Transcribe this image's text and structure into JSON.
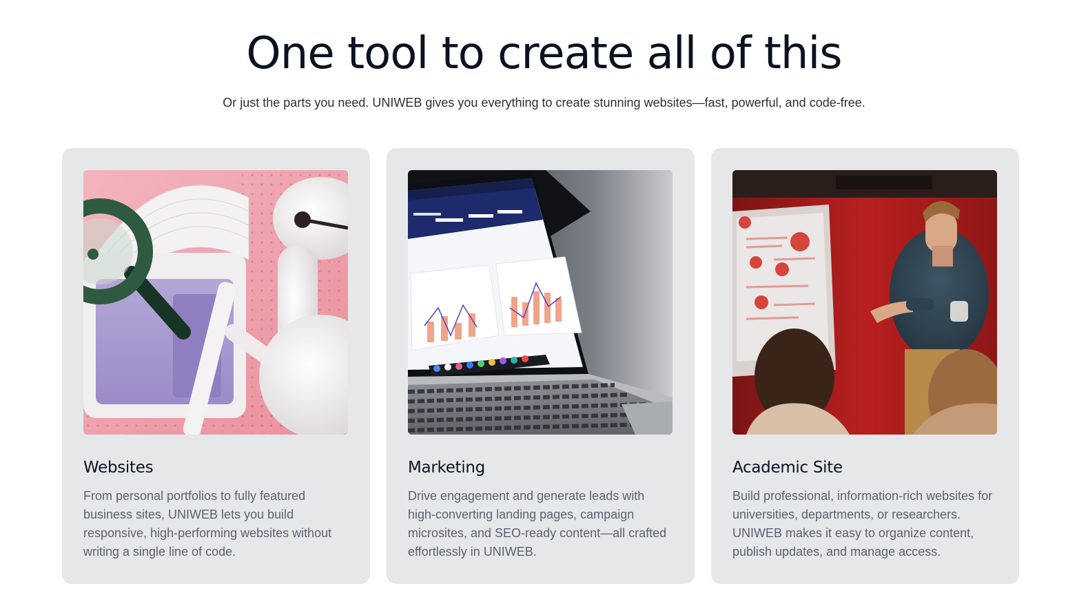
{
  "hero": {
    "title": "One tool to create all of this",
    "subtitle": "Or just the parts you need. UNIWEB gives you everything to create stunning websites—fast, powerful, and code-free."
  },
  "cards": [
    {
      "title": "Websites",
      "description": "From personal portfolios to fully featured business sites, UNIWEB lets you build responsive, high-performing websites without writing a single line of code.",
      "image": "3d-illustration-robot-magnifier"
    },
    {
      "title": "Marketing",
      "description": "Drive engagement and generate leads with high-converting landing pages, campaign microsites, and SEO-ready content—all crafted effortlessly in UNIWEB.",
      "image": "laptop-analytics-dashboard"
    },
    {
      "title": "Academic Site",
      "description": "Build professional, information-rich websites for universities, departments, or researchers. UNIWEB makes it easy to organize content, publish updates, and manage access.",
      "image": "presenter-lecture-room"
    }
  ],
  "colors": {
    "card_bg": "#e6e7e9",
    "text_dark": "#0b1220",
    "text_muted": "#5a6270"
  }
}
